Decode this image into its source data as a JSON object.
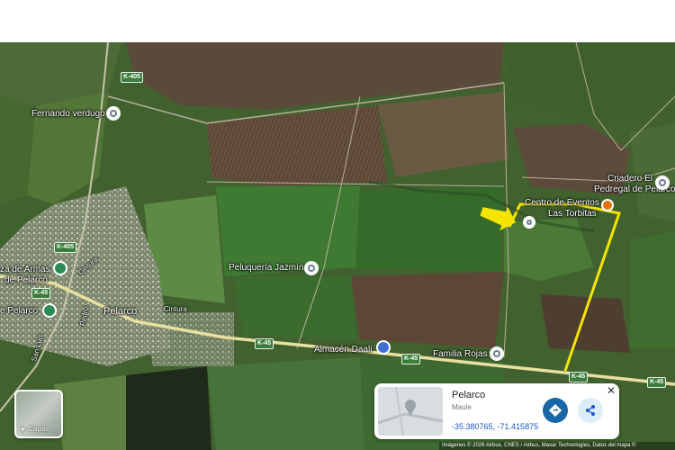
{
  "map": {
    "places": [
      {
        "id": "fernando",
        "label": "Fernando verdugo"
      },
      {
        "id": "criadero",
        "label_line1": "Criadero El",
        "label_line2": "Pedregal de Pelarco"
      },
      {
        "id": "centro",
        "label_line1": "Centro de Eventos",
        "label_line2": "Las Torbitas"
      },
      {
        "id": "peluqueria",
        "label": "Peluquería Jazmín"
      },
      {
        "id": "plaza",
        "label_line1": "za de Armas",
        "label_line2": "de Pelarco"
      },
      {
        "id": "pelarco_left",
        "label": "e Pelarco"
      },
      {
        "id": "pelarco_town",
        "label": "Pelarco"
      },
      {
        "id": "almacen",
        "label": "Almacén Daali"
      },
      {
        "id": "familia",
        "label": "Familia Rojas"
      }
    ],
    "streets": [
      {
        "id": "cintura1",
        "label": "Cintura"
      },
      {
        "id": "cintura2",
        "label": "Cintura"
      },
      {
        "id": "pedro",
        "label": "Pedro"
      },
      {
        "id": "sanluis",
        "label": "San Luis"
      }
    ],
    "road_shields": [
      {
        "id": "k405a",
        "label": "K-405"
      },
      {
        "id": "k405b",
        "label": "K-405"
      },
      {
        "id": "k45a",
        "label": "K-45"
      },
      {
        "id": "k45b",
        "label": "K-45"
      },
      {
        "id": "k45c",
        "label": "K-45"
      },
      {
        "id": "k45d",
        "label": "K-45"
      },
      {
        "id": "k45e",
        "label": "K-45"
      }
    ],
    "route_color": "#f5e400",
    "arrow_color": "#f5e400"
  },
  "layers": {
    "label": "Capas"
  },
  "card": {
    "title": "Pelarco",
    "subtitle": "Maule",
    "coords": "-35.380765, -71.415875",
    "close": "✕"
  },
  "attribution": "Imágenes © 2026 Airbus, CNES / Airbus, Maxar Technologies, Datos del mapa ©"
}
